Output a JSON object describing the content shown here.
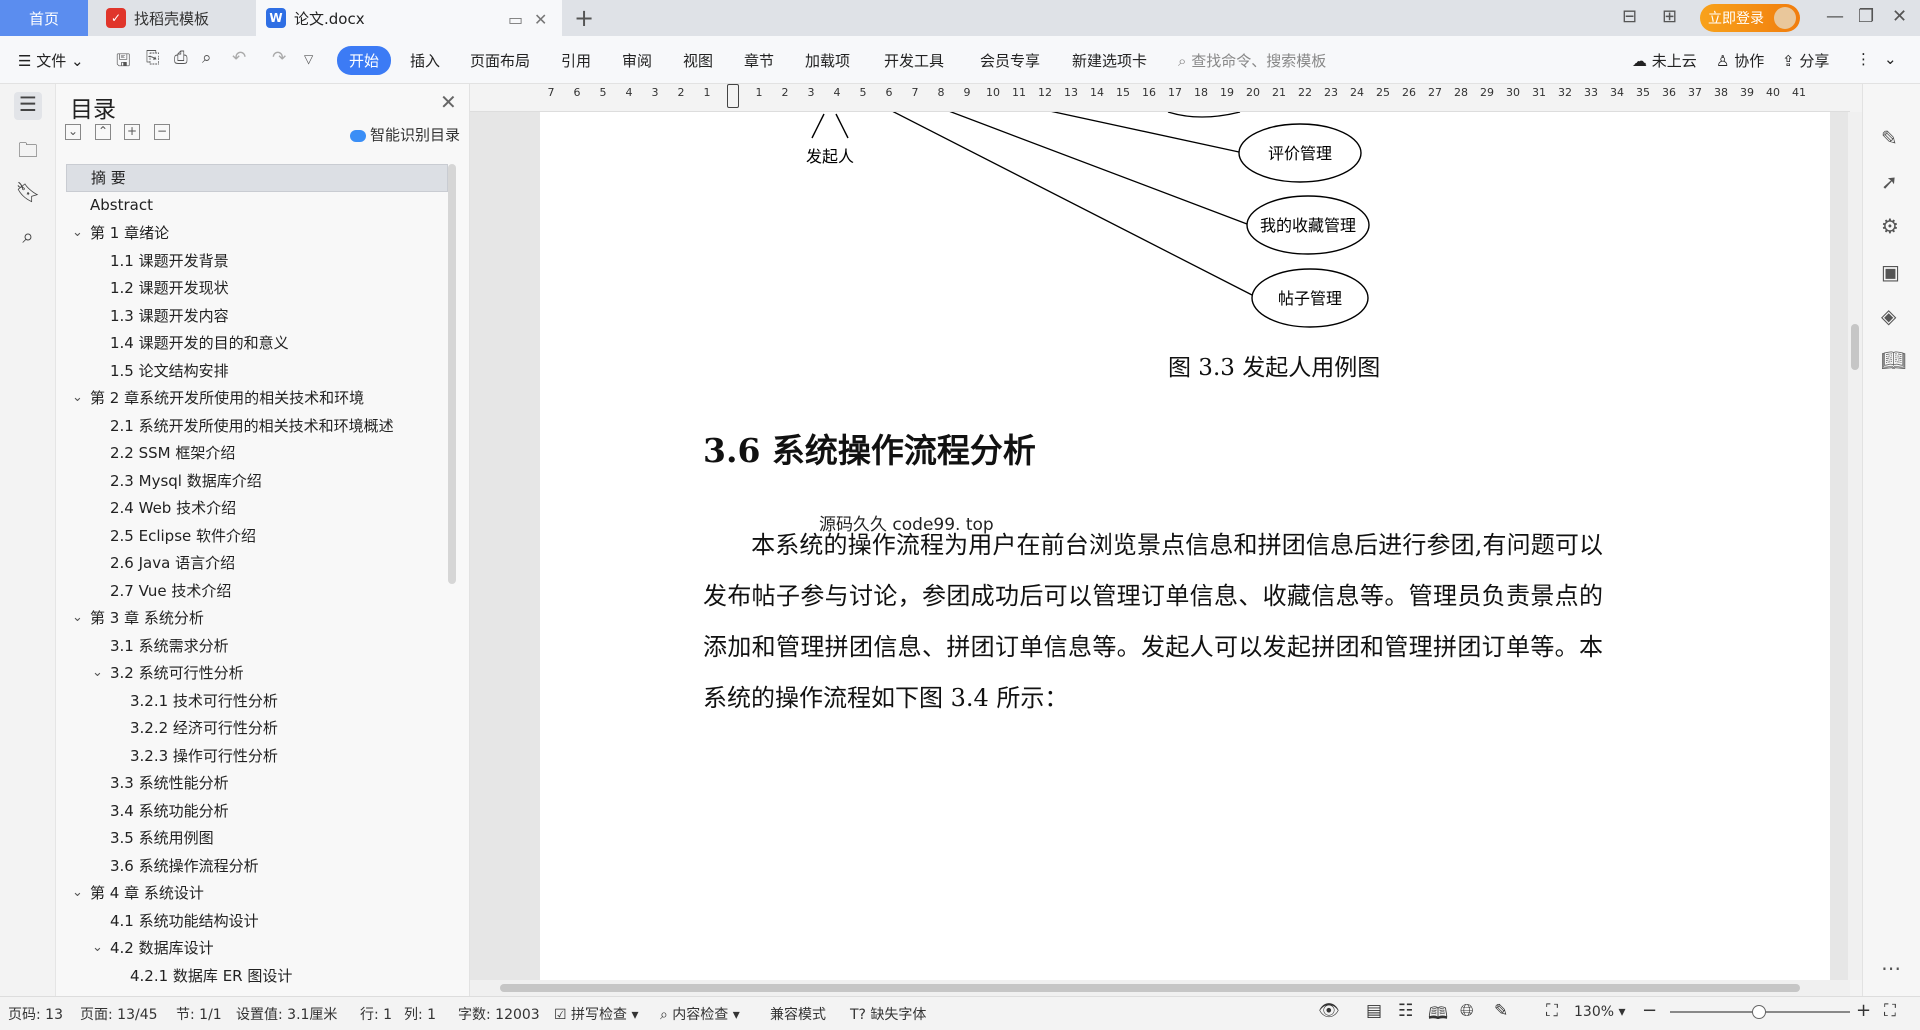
{
  "tabs": {
    "home": "首页",
    "template": "找稻壳模板",
    "doc": "论文.docx",
    "add_symbol": "+"
  },
  "account": {
    "login": "立即登录"
  },
  "menu": {
    "file": "文件",
    "items": [
      "开始",
      "插入",
      "页面布局",
      "引用",
      "审阅",
      "视图",
      "章节",
      "加载项",
      "开发工具",
      "会员专享",
      "新建选项卡"
    ],
    "search_placeholder": "查找命令、搜索模板",
    "cloud": "未上云",
    "collab": "协作",
    "share": "分享"
  },
  "toc": {
    "title": "目录",
    "ai_button": "智能识别目录",
    "items": [
      {
        "label": "摘  要",
        "level": 1,
        "active": true
      },
      {
        "label": "Abstract",
        "level": 1
      },
      {
        "label": "第 1 章绪论",
        "level": 1,
        "expanded": true
      },
      {
        "label": "1.1 课题开发背景",
        "level": 2
      },
      {
        "label": "1.2 课题开发现状",
        "level": 2
      },
      {
        "label": "1.3 课题开发内容",
        "level": 2
      },
      {
        "label": "1.4 课题开发的目的和意义",
        "level": 2
      },
      {
        "label": "1.5 论文结构安排",
        "level": 2
      },
      {
        "label": "第 2 章系统开发所使用的相关技术和环境",
        "level": 1,
        "expanded": true
      },
      {
        "label": "2.1 系统开发所使用的相关技术和环境概述",
        "level": 2
      },
      {
        "label": "2.2 SSM 框架介绍",
        "level": 2
      },
      {
        "label": "2.3 Mysql 数据库介绍",
        "level": 2
      },
      {
        "label": "2.4 Web 技术介绍",
        "level": 2
      },
      {
        "label": "2.5 Eclipse 软件介绍",
        "level": 2
      },
      {
        "label": "2.6 Java 语言介绍",
        "level": 2
      },
      {
        "label": "2.7 Vue 技术介绍",
        "level": 2
      },
      {
        "label": "第 3 章  系统分析",
        "level": 1,
        "expanded": true
      },
      {
        "label": "3.1 系统需求分析",
        "level": 2
      },
      {
        "label": "3.2 系统可行性分析",
        "level": 2,
        "expanded": true
      },
      {
        "label": "3.2.1 技术可行性分析",
        "level": 3
      },
      {
        "label": "3.2.2 经济可行性分析",
        "level": 3
      },
      {
        "label": "3.2.3 操作可行性分析",
        "level": 3
      },
      {
        "label": "3.3 系统性能分析",
        "level": 2
      },
      {
        "label": "3.4  系统功能分析",
        "level": 2
      },
      {
        "label": "3.5 系统用例图",
        "level": 2
      },
      {
        "label": "3.6 系统操作流程分析",
        "level": 2
      },
      {
        "label": "第 4 章  系统设计",
        "level": 1,
        "expanded": true
      },
      {
        "label": "4.1 系统功能结构设计",
        "level": 2
      },
      {
        "label": "4.2 数据库设计",
        "level": 2,
        "expanded": true
      },
      {
        "label": "4.2.1 数据库 ER 图设计",
        "level": 3
      }
    ]
  },
  "ruler": {
    "ticks": [
      "7",
      "6",
      "5",
      "4",
      "3",
      "2",
      "1",
      "1",
      "2",
      "3",
      "4",
      "5",
      "6",
      "7",
      "8",
      "9",
      "10",
      "11",
      "12",
      "13",
      "14",
      "15",
      "16",
      "17",
      "18",
      "19",
      "20",
      "21",
      "22",
      "23",
      "24",
      "25",
      "26",
      "27",
      "28",
      "29",
      "30",
      "31",
      "32",
      "33",
      "34",
      "35",
      "36",
      "37",
      "38",
      "39",
      "40",
      "41"
    ]
  },
  "document": {
    "diagram": {
      "actor": "发起人",
      "use_cases": [
        "评价管理",
        "我的收藏管理",
        "帖子管理"
      ]
    },
    "figure_caption": "图 3.3 发起人用例图",
    "heading": "3.6 系统操作流程分析",
    "watermark": "源码久久 code99. top",
    "paragraph": "本系统的操作流程为用户在前台浏览景点信息和拼团信息后进行参团,有问题可以发布帖子参与讨论，参团成功后可以管理订单信息、收藏信息等。管理员负责景点的添加和管理拼团信息、拼团订单信息等。发起人可以发起拼团和管理拼团订单等。本系统的操作流程如下图 3.4 所示："
  },
  "status": {
    "page_code": "页码: 13",
    "page": "页面: 13/45",
    "section": "节: 1/1",
    "setting": "设置值: 3.1厘米",
    "row": "行: 1",
    "col": "列: 1",
    "words": "字数: 12003",
    "spell": "拼写检查",
    "content_check": "内容检查",
    "compat": "兼容模式",
    "missing_font": "缺失字体",
    "zoom": "130%"
  }
}
